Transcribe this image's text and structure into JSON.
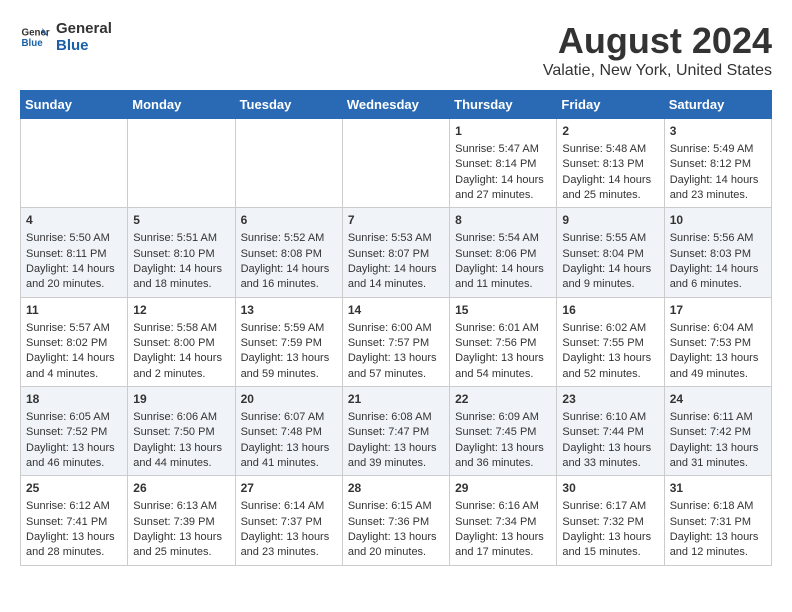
{
  "header": {
    "logo_line1": "General",
    "logo_line2": "Blue",
    "title": "August 2024",
    "subtitle": "Valatie, New York, United States"
  },
  "days_of_week": [
    "Sunday",
    "Monday",
    "Tuesday",
    "Wednesday",
    "Thursday",
    "Friday",
    "Saturday"
  ],
  "weeks": [
    [
      {
        "day": "",
        "content": ""
      },
      {
        "day": "",
        "content": ""
      },
      {
        "day": "",
        "content": ""
      },
      {
        "day": "",
        "content": ""
      },
      {
        "day": "1",
        "content": "Sunrise: 5:47 AM\nSunset: 8:14 PM\nDaylight: 14 hours\nand 27 minutes."
      },
      {
        "day": "2",
        "content": "Sunrise: 5:48 AM\nSunset: 8:13 PM\nDaylight: 14 hours\nand 25 minutes."
      },
      {
        "day": "3",
        "content": "Sunrise: 5:49 AM\nSunset: 8:12 PM\nDaylight: 14 hours\nand 23 minutes."
      }
    ],
    [
      {
        "day": "4",
        "content": "Sunrise: 5:50 AM\nSunset: 8:11 PM\nDaylight: 14 hours\nand 20 minutes."
      },
      {
        "day": "5",
        "content": "Sunrise: 5:51 AM\nSunset: 8:10 PM\nDaylight: 14 hours\nand 18 minutes."
      },
      {
        "day": "6",
        "content": "Sunrise: 5:52 AM\nSunset: 8:08 PM\nDaylight: 14 hours\nand 16 minutes."
      },
      {
        "day": "7",
        "content": "Sunrise: 5:53 AM\nSunset: 8:07 PM\nDaylight: 14 hours\nand 14 minutes."
      },
      {
        "day": "8",
        "content": "Sunrise: 5:54 AM\nSunset: 8:06 PM\nDaylight: 14 hours\nand 11 minutes."
      },
      {
        "day": "9",
        "content": "Sunrise: 5:55 AM\nSunset: 8:04 PM\nDaylight: 14 hours\nand 9 minutes."
      },
      {
        "day": "10",
        "content": "Sunrise: 5:56 AM\nSunset: 8:03 PM\nDaylight: 14 hours\nand 6 minutes."
      }
    ],
    [
      {
        "day": "11",
        "content": "Sunrise: 5:57 AM\nSunset: 8:02 PM\nDaylight: 14 hours\nand 4 minutes."
      },
      {
        "day": "12",
        "content": "Sunrise: 5:58 AM\nSunset: 8:00 PM\nDaylight: 14 hours\nand 2 minutes."
      },
      {
        "day": "13",
        "content": "Sunrise: 5:59 AM\nSunset: 7:59 PM\nDaylight: 13 hours\nand 59 minutes."
      },
      {
        "day": "14",
        "content": "Sunrise: 6:00 AM\nSunset: 7:57 PM\nDaylight: 13 hours\nand 57 minutes."
      },
      {
        "day": "15",
        "content": "Sunrise: 6:01 AM\nSunset: 7:56 PM\nDaylight: 13 hours\nand 54 minutes."
      },
      {
        "day": "16",
        "content": "Sunrise: 6:02 AM\nSunset: 7:55 PM\nDaylight: 13 hours\nand 52 minutes."
      },
      {
        "day": "17",
        "content": "Sunrise: 6:04 AM\nSunset: 7:53 PM\nDaylight: 13 hours\nand 49 minutes."
      }
    ],
    [
      {
        "day": "18",
        "content": "Sunrise: 6:05 AM\nSunset: 7:52 PM\nDaylight: 13 hours\nand 46 minutes."
      },
      {
        "day": "19",
        "content": "Sunrise: 6:06 AM\nSunset: 7:50 PM\nDaylight: 13 hours\nand 44 minutes."
      },
      {
        "day": "20",
        "content": "Sunrise: 6:07 AM\nSunset: 7:48 PM\nDaylight: 13 hours\nand 41 minutes."
      },
      {
        "day": "21",
        "content": "Sunrise: 6:08 AM\nSunset: 7:47 PM\nDaylight: 13 hours\nand 39 minutes."
      },
      {
        "day": "22",
        "content": "Sunrise: 6:09 AM\nSunset: 7:45 PM\nDaylight: 13 hours\nand 36 minutes."
      },
      {
        "day": "23",
        "content": "Sunrise: 6:10 AM\nSunset: 7:44 PM\nDaylight: 13 hours\nand 33 minutes."
      },
      {
        "day": "24",
        "content": "Sunrise: 6:11 AM\nSunset: 7:42 PM\nDaylight: 13 hours\nand 31 minutes."
      }
    ],
    [
      {
        "day": "25",
        "content": "Sunrise: 6:12 AM\nSunset: 7:41 PM\nDaylight: 13 hours\nand 28 minutes."
      },
      {
        "day": "26",
        "content": "Sunrise: 6:13 AM\nSunset: 7:39 PM\nDaylight: 13 hours\nand 25 minutes."
      },
      {
        "day": "27",
        "content": "Sunrise: 6:14 AM\nSunset: 7:37 PM\nDaylight: 13 hours\nand 23 minutes."
      },
      {
        "day": "28",
        "content": "Sunrise: 6:15 AM\nSunset: 7:36 PM\nDaylight: 13 hours\nand 20 minutes."
      },
      {
        "day": "29",
        "content": "Sunrise: 6:16 AM\nSunset: 7:34 PM\nDaylight: 13 hours\nand 17 minutes."
      },
      {
        "day": "30",
        "content": "Sunrise: 6:17 AM\nSunset: 7:32 PM\nDaylight: 13 hours\nand 15 minutes."
      },
      {
        "day": "31",
        "content": "Sunrise: 6:18 AM\nSunset: 7:31 PM\nDaylight: 13 hours\nand 12 minutes."
      }
    ]
  ]
}
